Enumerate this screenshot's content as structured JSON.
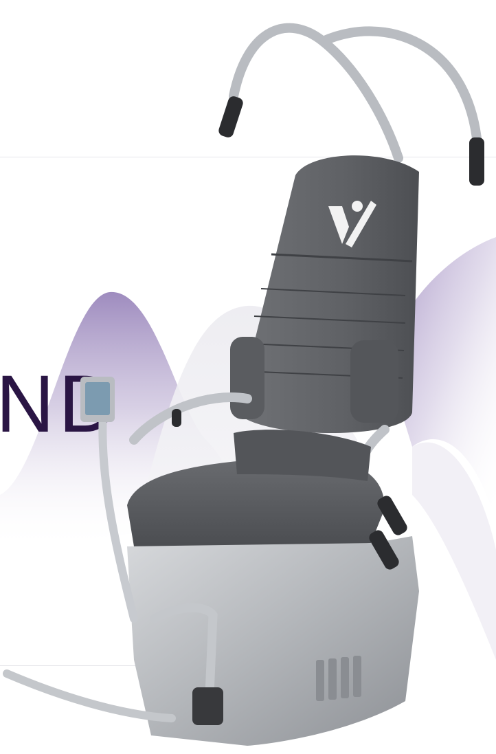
{
  "headline_fragment": "ND",
  "brand": {
    "logo_icon": "person-v-logo-icon",
    "accent_color": "#2a1544",
    "wave_color": "#8d77b3"
  },
  "product": {
    "icon": "rotational-chair-image",
    "upholstery_color": "#5f6164",
    "frame_color": "#c9ccd0"
  }
}
